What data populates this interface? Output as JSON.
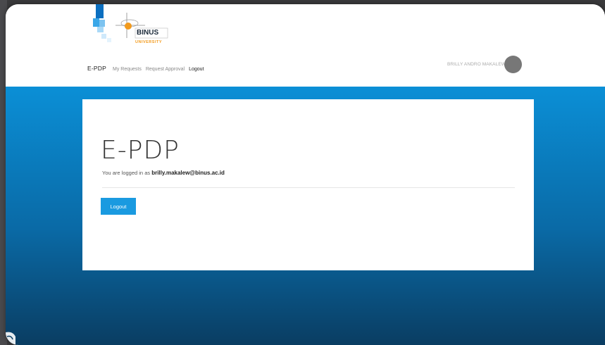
{
  "logo": {
    "name": "BINUS",
    "tagline": "UNIVERSITY"
  },
  "nav": {
    "brand": "E-PDP",
    "links": [
      "My Requests",
      "Request Approval",
      "Logout"
    ]
  },
  "user": {
    "name": "BRILLY ANDRO MAKALEW"
  },
  "card": {
    "title": "E-PDP",
    "sub_prefix": "You are logged in as ",
    "email": "brilly.makalew@binus.ac.id",
    "button_label": "Logout"
  },
  "colors": {
    "accent": "#1a9ae0",
    "gradient_top": "#0b8fd6",
    "gradient_bottom": "#0a3d62",
    "avatar": "#777777"
  }
}
